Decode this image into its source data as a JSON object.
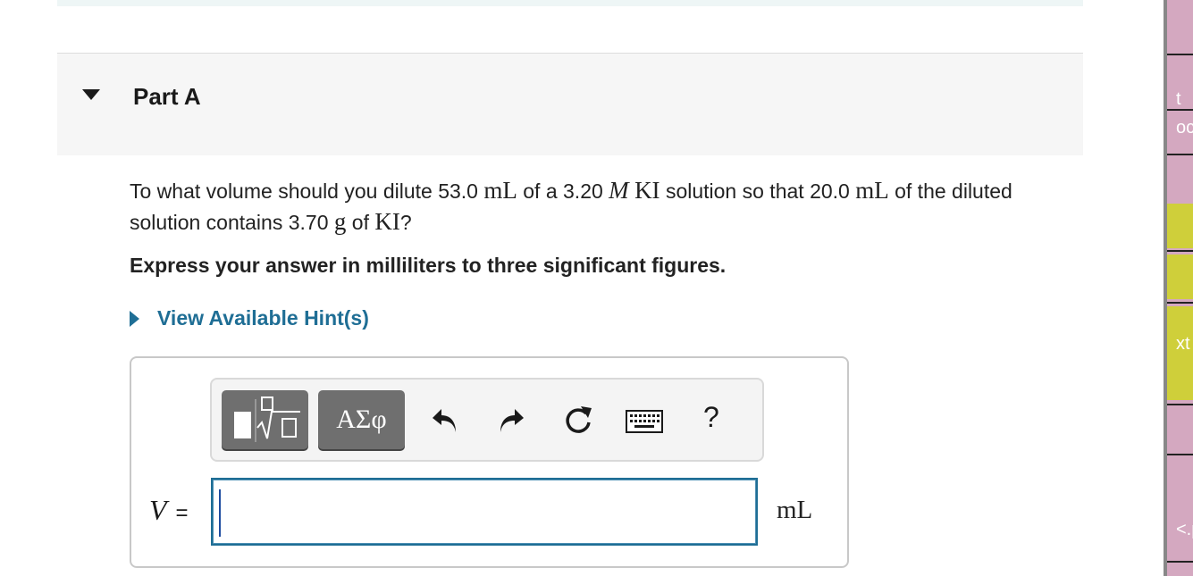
{
  "part": {
    "title": "Part A"
  },
  "question": {
    "p1": "To what volume should you dilute ",
    "v1": "53.0",
    "u1": "mL",
    "p2": " of a ",
    "conc": "3.20",
    "m": "M",
    "ki1": "KI",
    "p3": " solution so that ",
    "v2": "20.0",
    "u2": "mL",
    "p4": " of the diluted solution contains ",
    "mass": "3.70",
    "g": "g",
    "p5": " of ",
    "ki2": "KI",
    "p6": "?"
  },
  "instruction": "Express your answer in milliliters to three significant figures.",
  "hint": {
    "label": "View Available Hint(s)"
  },
  "toolbar": {
    "greek_label": "ΑΣφ",
    "help_label": "?",
    "icons": [
      "templates-icon",
      "greek-symbols-icon",
      "undo-icon",
      "redo-icon",
      "reset-icon",
      "keyboard-icon",
      "help-icon"
    ]
  },
  "answer": {
    "variable": "V",
    "equals": "=",
    "value": "",
    "unit": "mL"
  },
  "side_panel": {
    "frag1": "t",
    "frag2": "oc",
    "frag3": "xt",
    "frag4": "<.p"
  },
  "colors": {
    "link": "#1f6e95",
    "input_border": "#1f6e95",
    "toolbar_button": "#6f6f6f",
    "side_panel": "#d4a8c0",
    "side_highlight": "#cfcf3a"
  }
}
